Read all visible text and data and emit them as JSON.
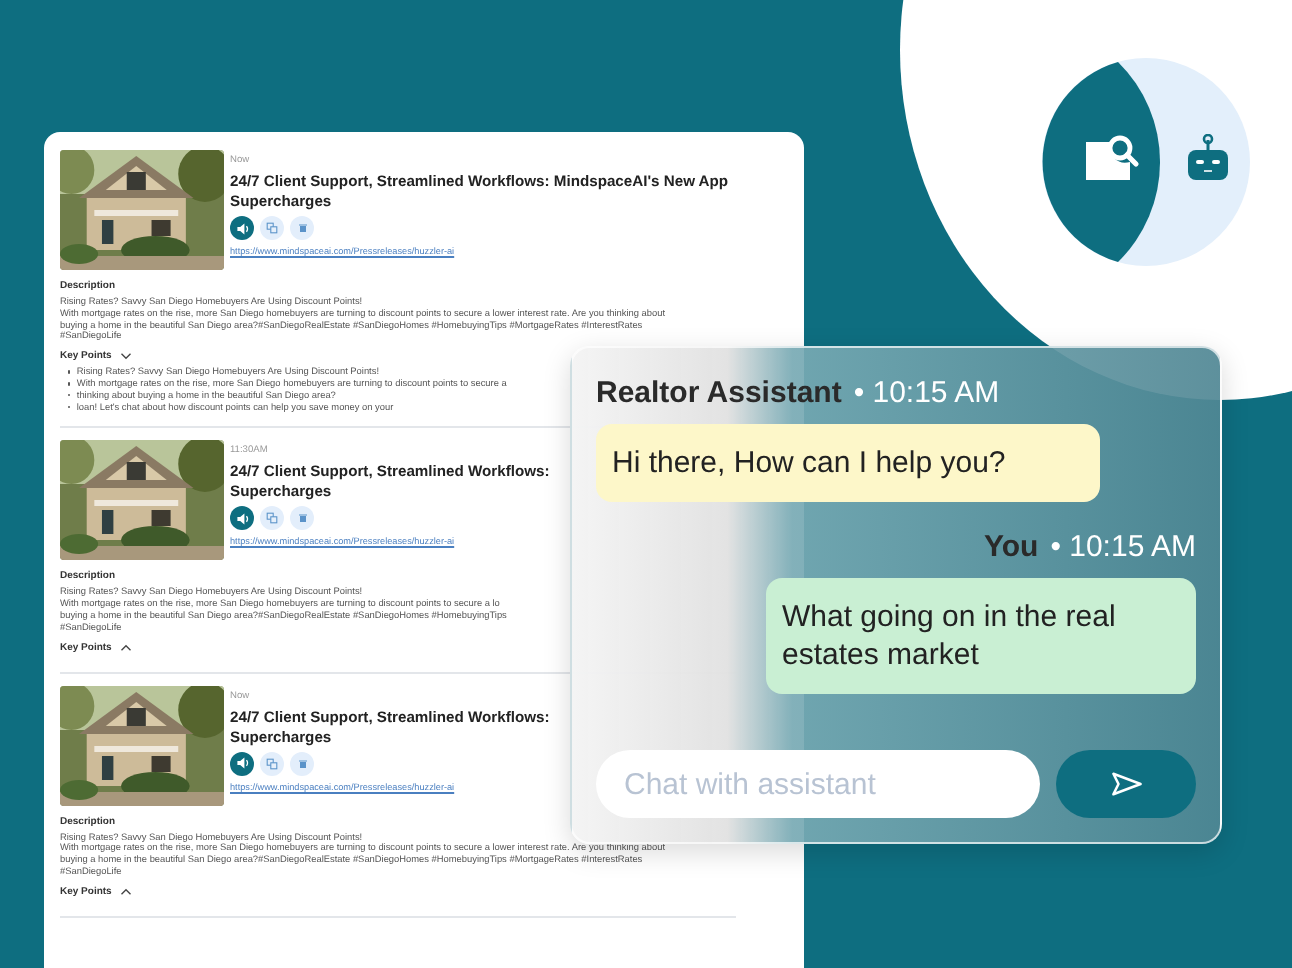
{
  "feed": {
    "cards": [
      {
        "time": "Now",
        "title": "24/7 Client Support, Streamlined Workflows: MindspaceAI's New App Supercharges",
        "actions": [
          {
            "kind": "audio"
          },
          {
            "kind": "copy"
          },
          {
            "kind": "delete"
          }
        ],
        "link": "https://www.mindspaceai.com/Pressreleases/huzzler-ai",
        "description_label": "Description",
        "description_lines": [
          "Rising Rates? Savvy San Diego Homebuyers Are Using Discount Points!",
          "With mortgage rates on the rise, more San Diego homebuyers are turning to discount points to secure a lower interest rate.  Are you thinking about",
          "buying a home in the beautiful San Diego area?#SanDiegoRealEstate #SanDiegoHomes #HomebuyingTips #MortgageRates #InterestRates",
          "#SanDiegoLife"
        ],
        "key_points_label": "Key Points",
        "expanded": true,
        "key_points": [
          "Rising Rates? Savvy San Diego Homebuyers Are Using Discount Points!",
          "With mortgage rates on the rise, more San Diego homebuyers are turning to discount points to secure a",
          "thinking about buying a home in the beautiful San Diego area?",
          "loan! Let's chat about how discount points can help you save money on your"
        ]
      },
      {
        "time": "11:30AM",
        "title": "24/7 Client Support, Streamlined Workflows:",
        "title_2": "Supercharges",
        "actions": [
          {
            "kind": "audio"
          },
          {
            "kind": "copy"
          },
          {
            "kind": "delete"
          }
        ],
        "link": "https://www.mindspaceai.com/Pressreleases/huzzler-ai",
        "description_label": "Description",
        "description_lines": [
          "Rising Rates? Savvy San Diego Homebuyers Are Using Discount Points!",
          "With mortgage rates on the rise, more San Diego homebuyers are turning to discount points to secure a lo",
          "buying a home in the beautiful San Diego area?#SanDiegoRealEstate #SanDiegoHomes #HomebuyingTips",
          "#SanDiegoLife"
        ],
        "key_points_label": "Key Points",
        "expanded": false
      },
      {
        "time": "Now",
        "title": "24/7 Client Support, Streamlined Workflows:",
        "title_2": "Supercharges",
        "actions": [
          {
            "kind": "audio"
          },
          {
            "kind": "copy"
          },
          {
            "kind": "delete"
          }
        ],
        "link": "https://www.mindspaceai.com/Pressreleases/huzzler-ai",
        "description_label": "Description",
        "description_lines": [
          "Rising Rates? Savvy San Diego Homebuyers Are Using Discount Points!",
          "With mortgage rates on the rise, more San Diego homebuyers are turning to discount points to secure a lower interest rate.  Are you thinking about",
          "buying a home in the beautiful San Diego area?#SanDiegoRealEstate #SanDiegoHomes #HomebuyingTips #MortgageRates #InterestRates",
          "#SanDiegoLife"
        ],
        "key_points_label": "Key Points",
        "expanded": false
      }
    ]
  },
  "chat": {
    "messages": [
      {
        "sender": "Realtor Assistant",
        "time": "• 10:15 AM",
        "text": "Hi there, How can I help you?",
        "kind": "assistant"
      },
      {
        "sender": "You",
        "time": "• 10:15 AM",
        "text": "What going on in the real estates market",
        "kind": "user"
      }
    ],
    "input": {
      "placeholder": "Chat with assistant"
    }
  }
}
